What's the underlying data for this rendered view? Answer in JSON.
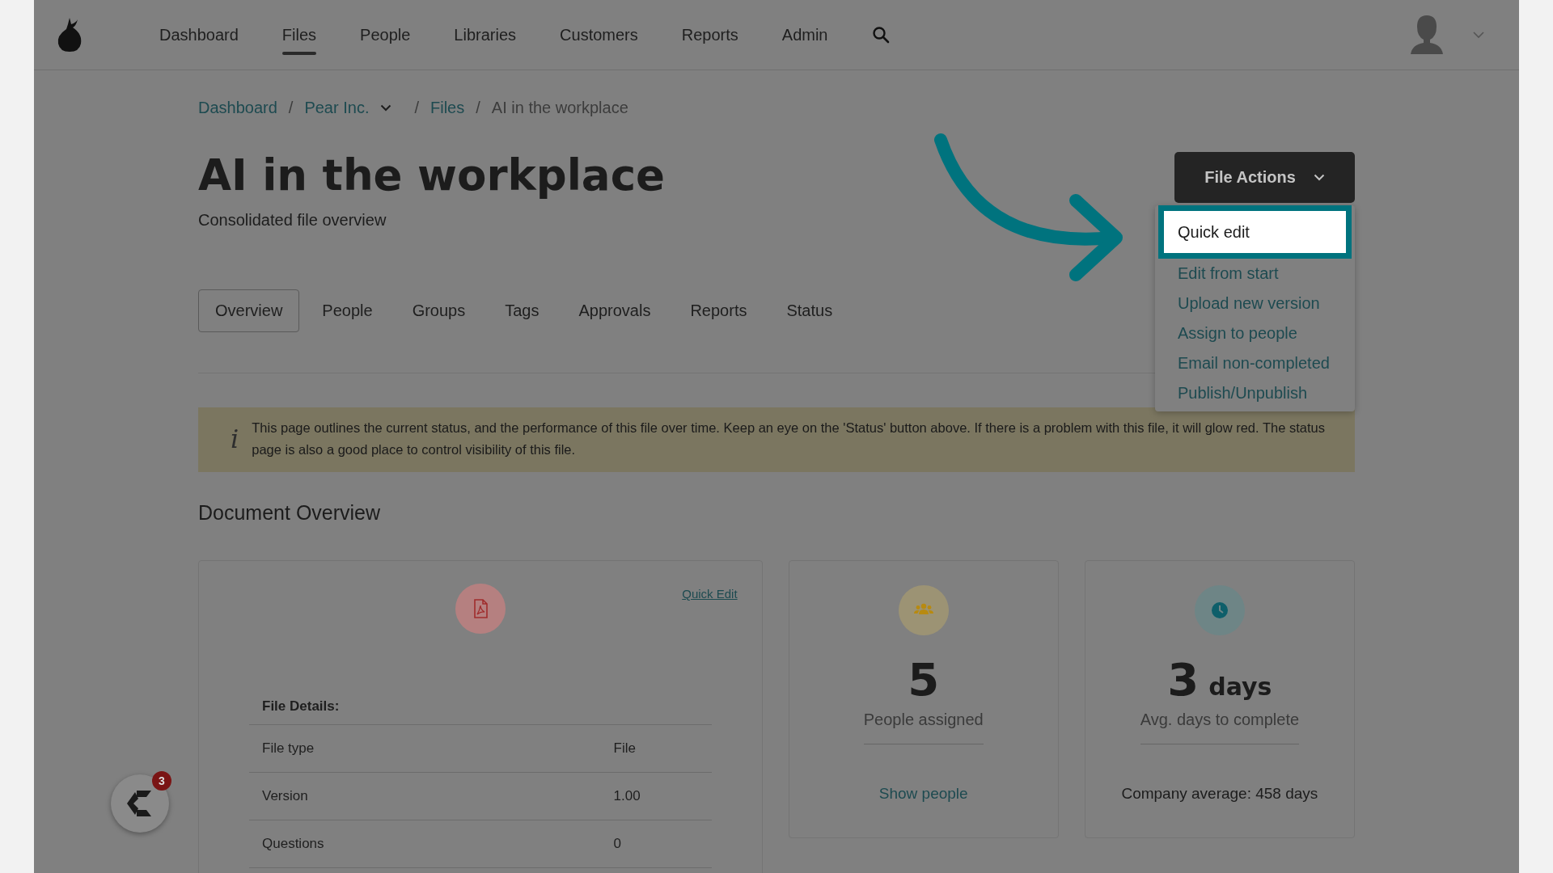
{
  "nav": {
    "items": [
      {
        "label": "Dashboard",
        "selected": false
      },
      {
        "label": "Files",
        "selected": true
      },
      {
        "label": "People",
        "selected": false
      },
      {
        "label": "Libraries",
        "selected": false
      },
      {
        "label": "Customers",
        "selected": false
      },
      {
        "label": "Reports",
        "selected": false
      },
      {
        "label": "Admin",
        "selected": false
      }
    ]
  },
  "breadcrumb": [
    {
      "label": "Dashboard",
      "kind": "link"
    },
    {
      "separator": "/",
      "label": "Pear Inc.",
      "kind": "dropdown"
    },
    {
      "separator": "/",
      "label": "Files",
      "kind": "link"
    },
    {
      "separator": "/",
      "label": "AI in the workplace",
      "kind": "current"
    }
  ],
  "title": "AI in the workplace",
  "subtitle": "Consolidated file overview",
  "file_actions": {
    "label": "File Actions",
    "menu": [
      {
        "label": "Quick edit",
        "highlighted": true
      },
      {
        "label": "Edit from start",
        "highlighted": false
      },
      {
        "label": "Upload new version",
        "highlighted": false
      },
      {
        "label": "Assign to people",
        "highlighted": false
      },
      {
        "label": "Email non-completed",
        "highlighted": false
      },
      {
        "label": "Publish/Unpublish",
        "highlighted": false
      }
    ]
  },
  "tabs": [
    {
      "label": "Overview",
      "selected": true
    },
    {
      "label": "People",
      "selected": false
    },
    {
      "label": "Groups",
      "selected": false
    },
    {
      "label": "Tags",
      "selected": false
    },
    {
      "label": "Approvals",
      "selected": false
    },
    {
      "label": "Reports",
      "selected": false
    },
    {
      "label": "Status",
      "selected": false
    }
  ],
  "banner": {
    "glyph": "i",
    "text": "This page outlines the current status, and the performance of this file over time. Keep an eye on the 'Status' button above. If there is a problem with this file, it will glow red. The status page is also a good place to control visibility of this file."
  },
  "section_heading": "Document Overview",
  "file_card": {
    "link": "Quick Edit",
    "details_heading": "File Details:",
    "rows": [
      {
        "label": "File type",
        "value": "File"
      },
      {
        "label": "Version",
        "value": "1.00"
      },
      {
        "label": "Questions",
        "value": "0"
      }
    ]
  },
  "stat_cards": [
    {
      "kind": "people",
      "value": "5",
      "caption": "People assigned",
      "footer": {
        "kind": "link",
        "text": "Show people"
      }
    },
    {
      "kind": "time",
      "value": "3",
      "unit": "days",
      "caption": "Avg. days to complete",
      "footer": {
        "kind": "text",
        "text": "Company average:  458 days"
      }
    }
  ],
  "chat_widget": {
    "badge": "3"
  }
}
